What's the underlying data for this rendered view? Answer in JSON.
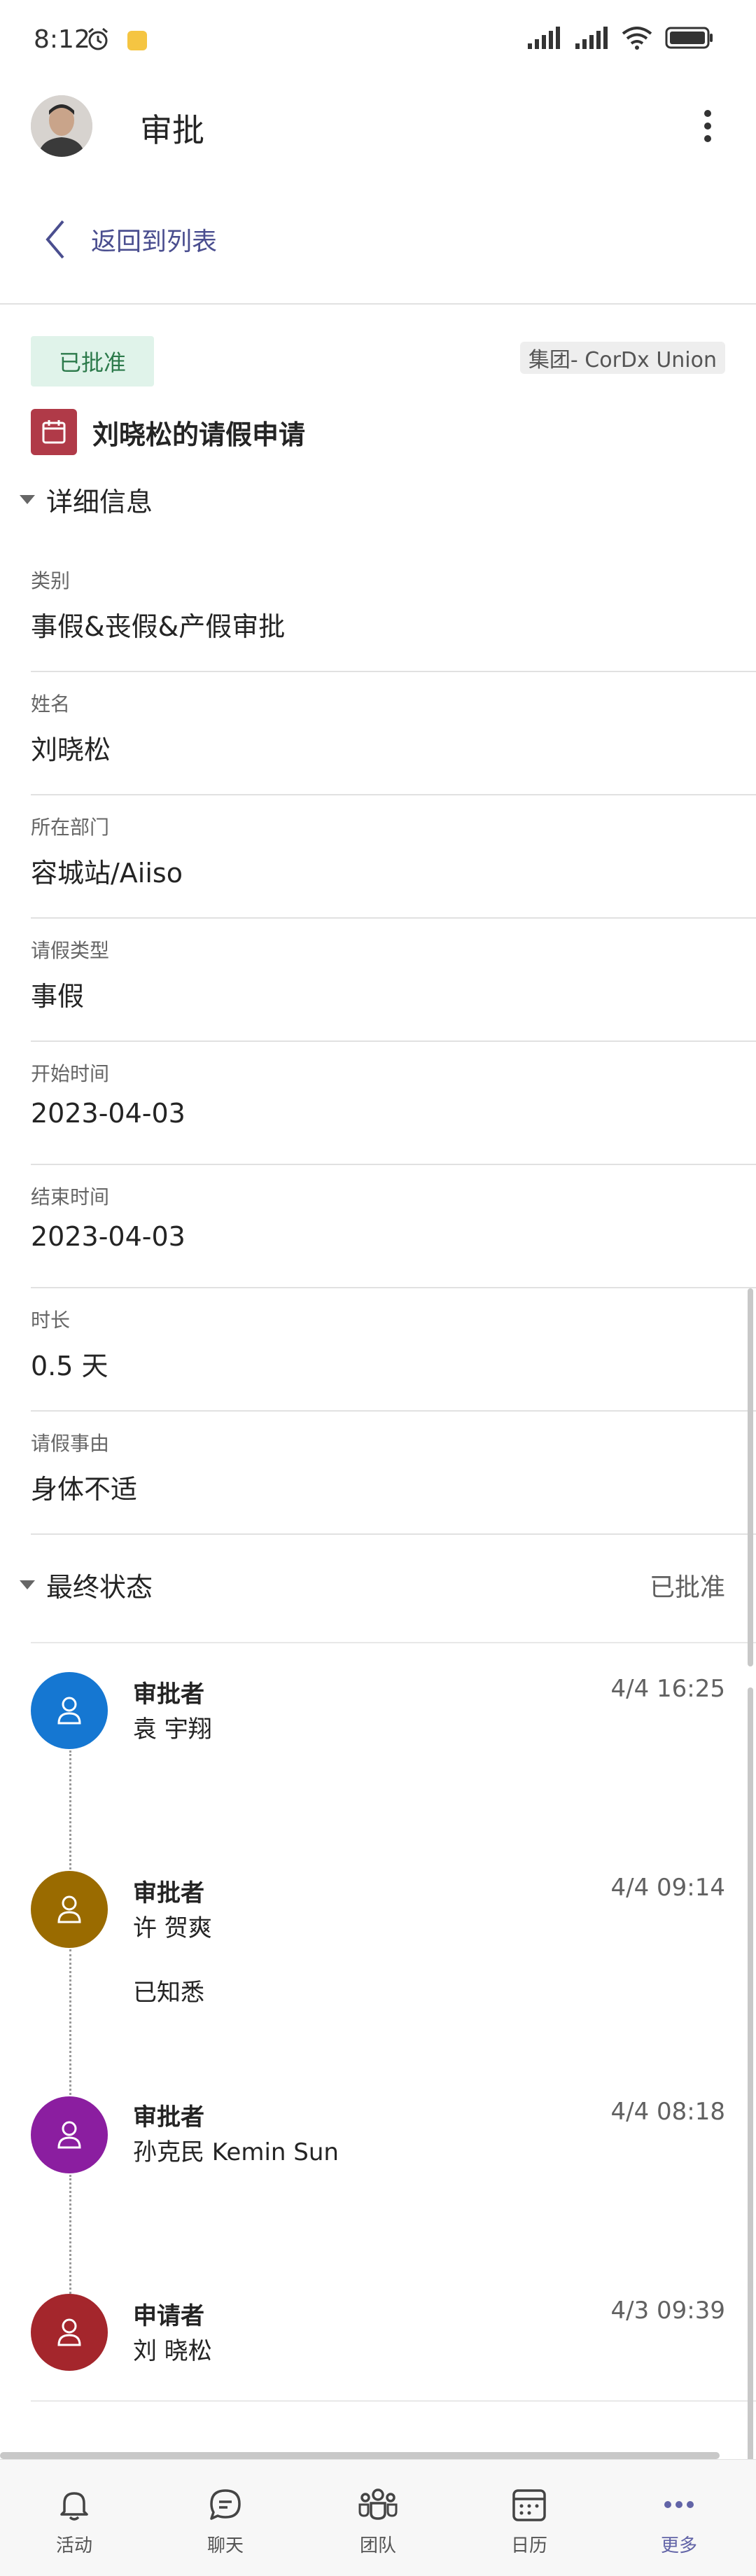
{
  "status_bar": {
    "time": "8:12"
  },
  "header": {
    "title": "审批"
  },
  "nav": {
    "back_label": "返回到列表"
  },
  "approval": {
    "status": "已批准",
    "org": "集团- CorDx Union",
    "title": "刘晓松的请假申请"
  },
  "details": {
    "section_title": "详细信息",
    "fields": [
      {
        "label": "类别",
        "value": "事假&丧假&产假审批"
      },
      {
        "label": "姓名",
        "value": "刘晓松"
      },
      {
        "label": "所在部门",
        "value": "容城站/Aiiso"
      },
      {
        "label": "请假类型",
        "value": "事假"
      },
      {
        "label": "开始时间",
        "value": "2023-04-03"
      },
      {
        "label": "结束时间",
        "value": "2023-04-03"
      },
      {
        "label": "时长",
        "value": "0.5 天"
      },
      {
        "label": "请假事由",
        "value": "身体不适"
      }
    ]
  },
  "final": {
    "section_title": "最终状态",
    "status": "已批准"
  },
  "timeline": [
    {
      "role": "审批者",
      "name": "袁 宇翔",
      "time": "4/4 16:25",
      "note": "",
      "color": "#1577d2"
    },
    {
      "role": "审批者",
      "name": "许 贺爽",
      "time": "4/4 09:14",
      "note": "已知悉",
      "color": "#9a6b00"
    },
    {
      "role": "审批者",
      "name": "孙克民 Kemin Sun",
      "time": "4/4 08:18",
      "note": "",
      "color": "#8b1ea0"
    },
    {
      "role": "申请者",
      "name": "刘 晓松",
      "time": "4/3 09:39",
      "note": "",
      "color": "#a4262c"
    }
  ],
  "bottom_nav": {
    "items": [
      {
        "label": "活动",
        "icon": "bell-icon"
      },
      {
        "label": "聊天",
        "icon": "chat-icon"
      },
      {
        "label": "团队",
        "icon": "teams-icon"
      },
      {
        "label": "日历",
        "icon": "calendar-icon"
      },
      {
        "label": "更多",
        "icon": "more-icon"
      }
    ],
    "active": "更多",
    "accent": "#6264a7"
  }
}
